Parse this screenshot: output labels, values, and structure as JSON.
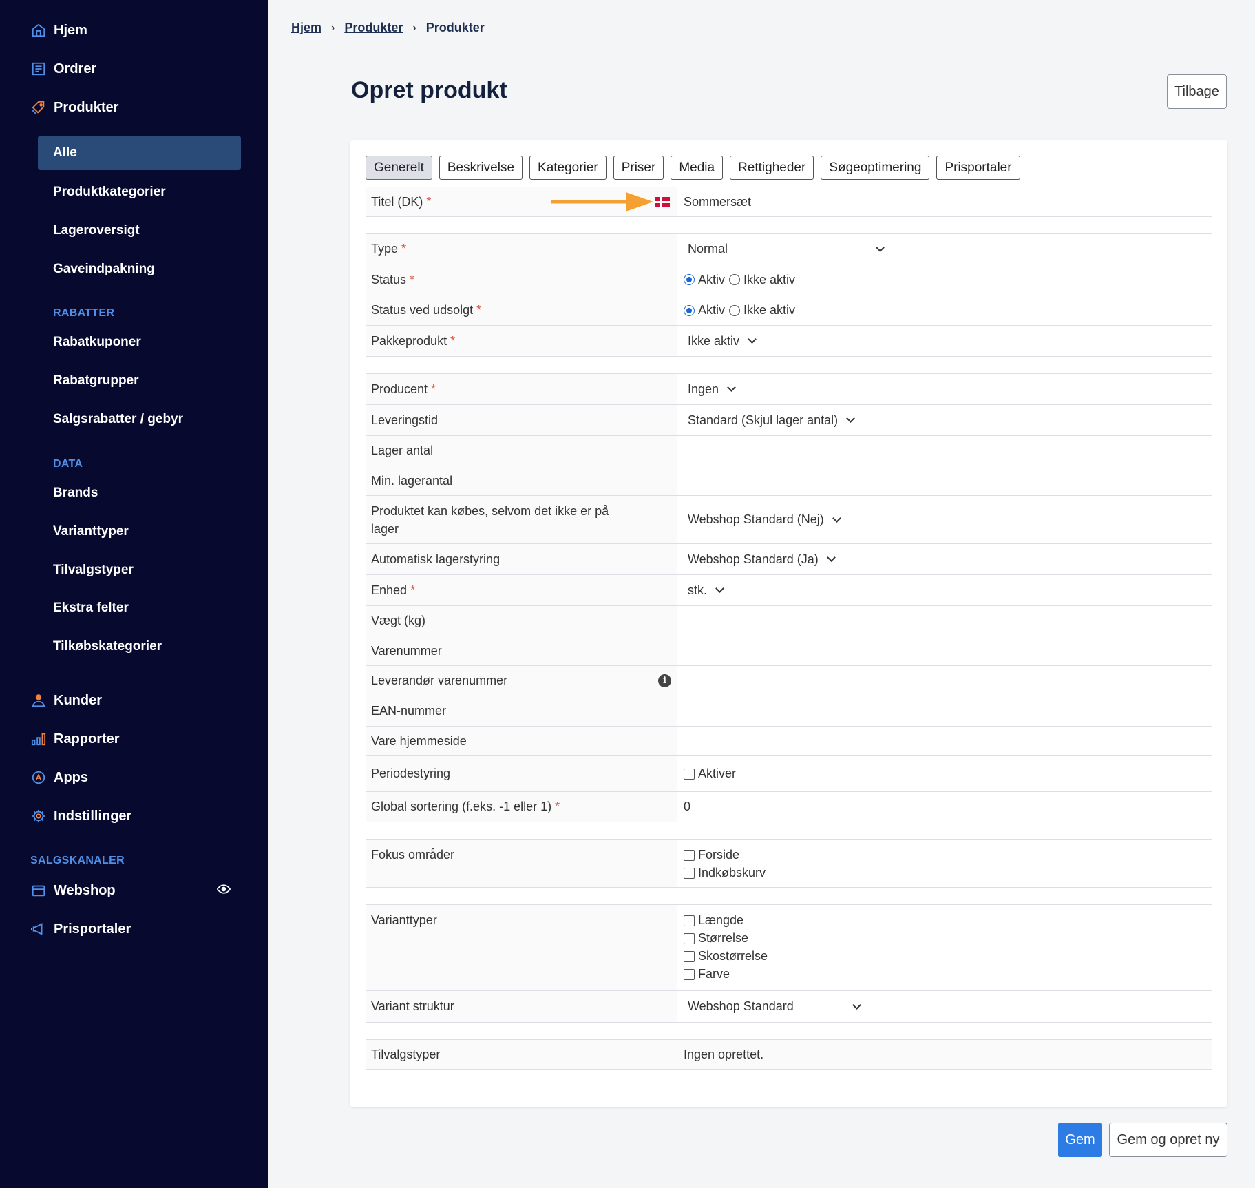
{
  "sidebar": {
    "nav": [
      {
        "label": "Hjem",
        "icon": "home-icon"
      },
      {
        "label": "Ordrer",
        "icon": "orders-icon"
      },
      {
        "label": "Produkter",
        "icon": "tag-icon"
      }
    ],
    "products_sub": [
      "Alle",
      "Produktkategorier",
      "Lageroversigt",
      "Gaveindpakning"
    ],
    "sections": {
      "rabatter": "RABATTER",
      "data": "DATA",
      "salgskanaler": "SALGSKANALER"
    },
    "rabatter_items": [
      "Rabatkuponer",
      "Rabatgrupper",
      "Salgsrabatter / gebyr"
    ],
    "data_items": [
      "Brands",
      "Varianttyper",
      "Tilvalgstyper",
      "Ekstra felter",
      "Tilkøbskategorier"
    ],
    "nav2": [
      {
        "label": "Kunder",
        "icon": "user-icon"
      },
      {
        "label": "Rapporter",
        "icon": "bar-chart-icon"
      },
      {
        "label": "Apps",
        "icon": "apps-icon"
      },
      {
        "label": "Indstillinger",
        "icon": "gear-icon"
      }
    ],
    "channels": [
      {
        "label": "Webshop",
        "icon": "store-icon"
      },
      {
        "label": "Prisportaler",
        "icon": "megaphone-icon"
      }
    ]
  },
  "breadcrumb": [
    "Hjem",
    "Produkter",
    "Produkter"
  ],
  "page": {
    "title": "Opret produkt",
    "back_label": "Tilbage"
  },
  "tabs": [
    "Generelt",
    "Beskrivelse",
    "Kategorier",
    "Priser",
    "Media",
    "Rettigheder",
    "Søgeoptimering",
    "Prisportaler"
  ],
  "form": {
    "title_label": "Titel (DK)",
    "title_value": "Sommersæt",
    "type_label": "Type",
    "type_value": "Normal",
    "status_label": "Status",
    "status_sold_label": "Status ved udsolgt",
    "radio_active": "Aktiv",
    "radio_inactive": "Ikke aktiv",
    "package_label": "Pakkeprodukt",
    "package_value": "Ikke aktiv",
    "producer_label": "Producent",
    "producer_value": "Ingen",
    "delivery_label": "Leveringstid",
    "delivery_value": "Standard (Skjul lager antal)",
    "stock_label": "Lager antal",
    "min_stock_label": "Min. lagerantal",
    "buy_oos_label": "Produktet kan købes, selvom det ikke er på lager",
    "buy_oos_value": "Webshop Standard (Nej)",
    "auto_stock_label": "Automatisk lagerstyring",
    "auto_stock_value": "Webshop Standard (Ja)",
    "unit_label": "Enhed",
    "unit_value": "stk.",
    "weight_label": "Vægt (kg)",
    "sku_label": "Varenummer",
    "supplier_sku_label": "Leverandør varenummer",
    "ean_label": "EAN-nummer",
    "homepage_label": "Vare hjemmeside",
    "period_label": "Periodestyring",
    "period_value": "Aktiver",
    "sort_label": "Global sortering (f.eks. -1 eller 1)",
    "sort_value": "0",
    "focus_label": "Fokus områder",
    "focus_options": [
      "Forside",
      "Indkøbskurv"
    ],
    "variant_types_label": "Varianttyper",
    "variant_types_options": [
      "Længde",
      "Størrelse",
      "Skostørrelse",
      "Farve"
    ],
    "variant_structure_label": "Variant struktur",
    "variant_structure_value": "Webshop Standard",
    "addon_types_label": "Tilvalgstyper",
    "addon_types_value": "Ingen oprettet."
  },
  "actions": {
    "save": "Gem",
    "save_new": "Gem og opret ny"
  },
  "colors": {
    "sidebar_bg": "#070a2e",
    "active_item": "#2a4a78",
    "accent": "#2d7be5",
    "icon_accent": "#4f8fe8",
    "arrow": "#f5a033"
  }
}
